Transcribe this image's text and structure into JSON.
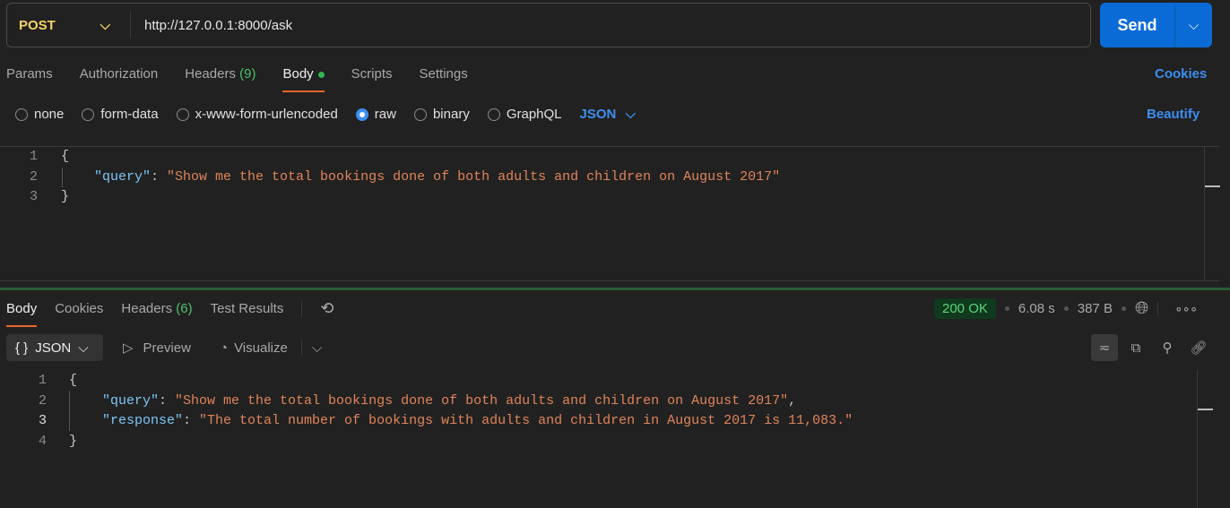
{
  "request": {
    "method": "POST",
    "url": "http://127.0.0.1:8000/ask",
    "send_label": "Send"
  },
  "req_tabs": {
    "params": "Params",
    "authorization": "Authorization",
    "headers": "Headers",
    "headers_count": "(9)",
    "body": "Body",
    "scripts": "Scripts",
    "settings": "Settings",
    "cookies": "Cookies"
  },
  "body_types": {
    "none": "none",
    "form_data": "form-data",
    "urlencoded": "x-www-form-urlencoded",
    "raw": "raw",
    "binary": "binary",
    "graphql": "GraphQL",
    "format": "JSON",
    "beautify": "Beautify",
    "selected": "raw"
  },
  "req_code": {
    "ln": [
      "1",
      "2",
      "3"
    ],
    "open": "{",
    "key": "\"query\"",
    "colon": ": ",
    "value": "\"Show me the total bookings done of both adults and children on August 2017\"",
    "close": "}"
  },
  "resp_tabs": {
    "body": "Body",
    "cookies": "Cookies",
    "headers": "Headers",
    "headers_count": "(6)",
    "tests": "Test Results"
  },
  "status": {
    "code": "200 OK",
    "time": "6.08 s",
    "size": "387 B",
    "color": "#5fd47c"
  },
  "resp_toolbar": {
    "format": "JSON",
    "preview": "Preview",
    "visualize": "Visualize"
  },
  "resp_code": {
    "ln": [
      "1",
      "2",
      "3",
      "4"
    ],
    "open": "{",
    "k1": "\"query\"",
    "v1": "\"Show me the total bookings done of both adults and children on August 2017\"",
    "comma": ",",
    "k2": "\"response\"",
    "v2": "\"The total number of bookings with adults and children in August 2017 is 11,083.\"",
    "colon": ": ",
    "close": "}"
  }
}
